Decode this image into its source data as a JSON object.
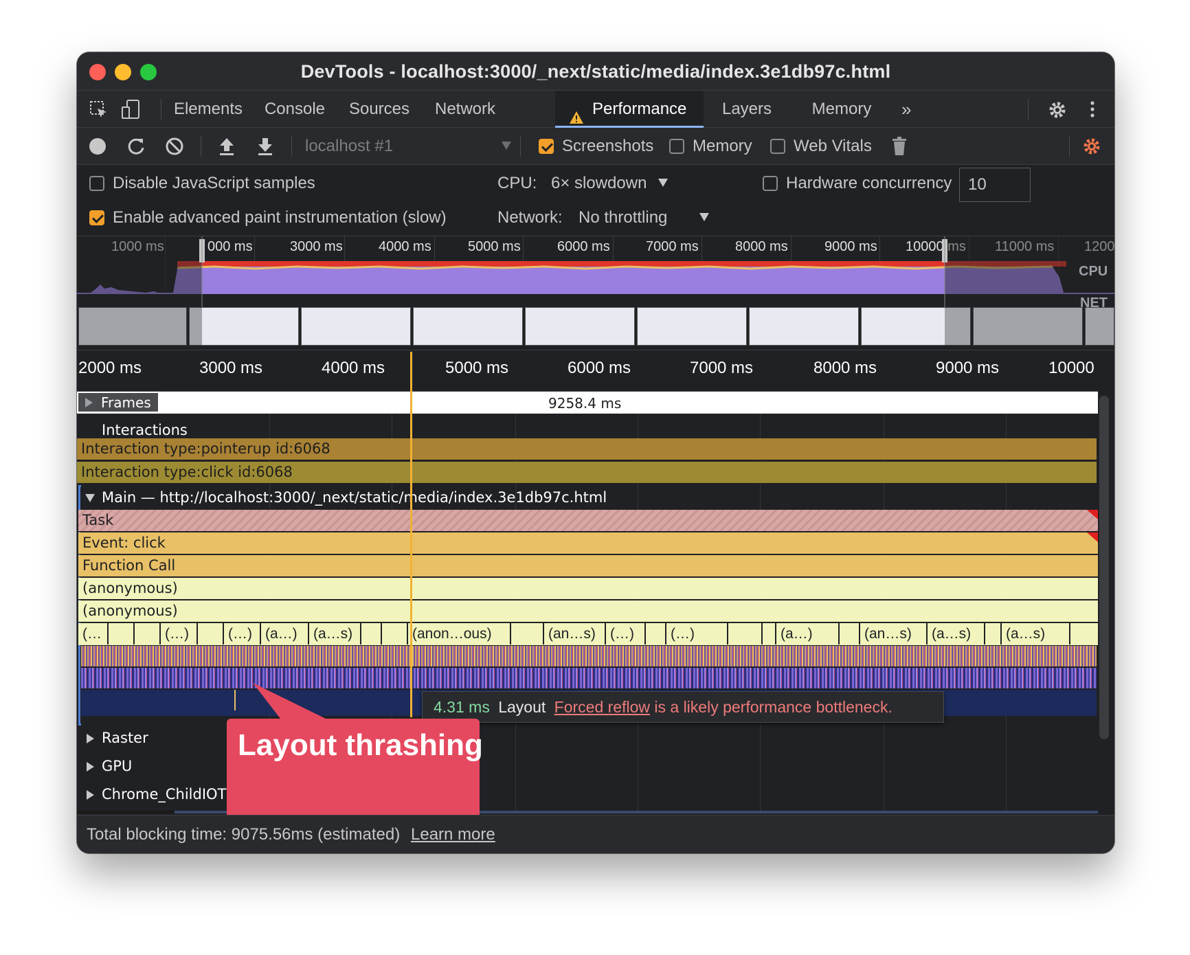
{
  "window": {
    "title": "DevTools - localhost:3000/_next/static/media/index.3e1db97c.html"
  },
  "tabs": [
    {
      "label": "Elements"
    },
    {
      "label": "Console"
    },
    {
      "label": "Sources"
    },
    {
      "label": "Network"
    },
    {
      "label": "Performance"
    },
    {
      "label": "Layers"
    },
    {
      "label": "Memory"
    }
  ],
  "toolbar": {
    "profile_select": "localhost #1",
    "screenshots_label": "Screenshots",
    "memory_label": "Memory",
    "web_vitals_label": "Web Vitals",
    "screenshots_checked": true,
    "memory_checked": false,
    "web_vitals_checked": false
  },
  "settings": {
    "disable_js_label": "Disable JavaScript samples",
    "advanced_paint_label": "Enable advanced paint instrumentation (slow)",
    "cpu_label": "CPU:",
    "cpu_value": "6× slowdown",
    "network_label": "Network:",
    "network_value": "No throttling",
    "hardware_label": "Hardware concurrency",
    "hardware_value": "10"
  },
  "overview": {
    "ticks": [
      "1000 ms",
      "000 ms",
      "3000 ms",
      "4000 ms",
      "5000 ms",
      "6000 ms",
      "7000 ms",
      "8000 ms",
      "9000 ms",
      "10000 ms",
      "11000 ms",
      "1200"
    ],
    "cpu_label": "CPU",
    "net_label": "NET"
  },
  "ruler": {
    "ticks": [
      "2000 ms",
      "3000 ms",
      "4000 ms",
      "5000 ms",
      "6000 ms",
      "7000 ms",
      "8000 ms",
      "9000 ms",
      "10000"
    ]
  },
  "tracks": {
    "frames_label": "Frames",
    "frames_duration": "9258.4 ms",
    "interactions_label": "Interactions",
    "interaction_pointerup": "Interaction type:pointerup id:6068",
    "interaction_click": "Interaction type:click id:6068",
    "main_label": "Main — http://localhost:3000/_next/static/media/index.3e1db97c.html",
    "task": "Task",
    "event_click": "Event: click",
    "function_call": "Function Call",
    "anonymous_1": "(anonymous)",
    "anonymous_2": "(anonymous)",
    "raster_label": "Raster",
    "gpu_label": "GPU",
    "child_label": "Chrome_ChildIOThread"
  },
  "small_calls": [
    "(…",
    "",
    "",
    "(…)",
    "",
    "(…)",
    "(a…)",
    "(a…s)",
    "",
    "",
    "(anon…ous)",
    "",
    "(an…s)",
    "(…)",
    "",
    "(…)",
    "",
    "",
    "(a…)",
    "",
    "(an…s)",
    "(a…s)",
    "",
    "(a…s)"
  ],
  "tooltip": {
    "duration": "4.31 ms",
    "name": "Layout",
    "link": "Forced reflow",
    "message": " is a likely performance bottleneck."
  },
  "callout": {
    "text": "Layout thrashing"
  },
  "status": {
    "text": "Total blocking time: 9075.56ms (estimated)",
    "link": "Learn more"
  },
  "colors": {
    "task_stripe": "#d9a6a6",
    "event": "#e8c066",
    "anon": "#f1f5bd",
    "interaction1": "#a98234",
    "interaction2": "#9d8b33",
    "callout": "#e5495f",
    "cpu_purple": "#9a7ee0",
    "reflow_link": "#ef7b7b"
  }
}
